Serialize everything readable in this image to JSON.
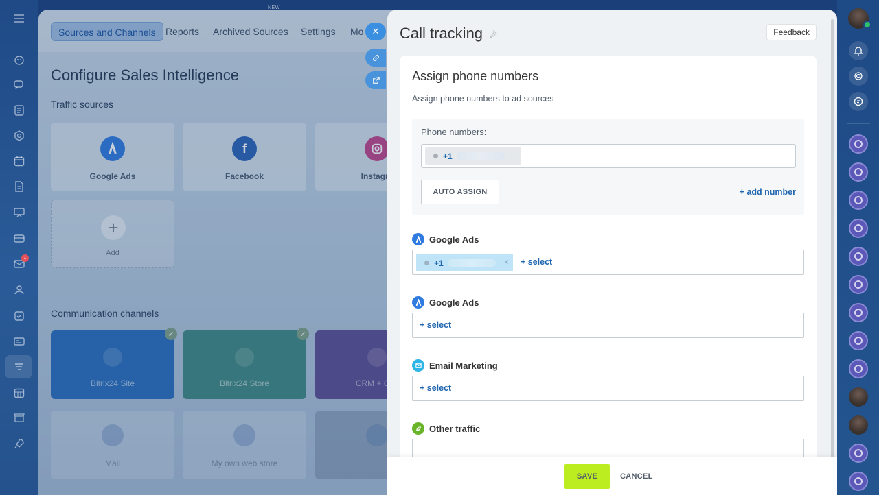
{
  "colors": {
    "accent_blue": "#2067b0",
    "save_green": "#bbed21",
    "frame_blue": "#1b3f78",
    "google_ads_icon": "#2f7be0",
    "email_icon": "#2fb4e8",
    "other_traffic_icon": "#6ab42a"
  },
  "icons": {
    "leftbar": [
      "menu-icon",
      "bot-icon",
      "chat-icon",
      "feed-icon",
      "hexagon-icon",
      "calendar-icon",
      "document-icon",
      "presentation-icon",
      "card-icon",
      "mail-icon",
      "users-icon",
      "checkbox-icon",
      "contact-card-icon",
      "filter-icon",
      "calendar-grid-icon",
      "store-icon",
      "rocket-icon"
    ],
    "rightbar": [
      "avatar",
      "bell-icon",
      "spiral-icon",
      "support-chat-icon"
    ]
  },
  "top_badge": "NEW",
  "background_app": {
    "tabs": [
      "Sources and Channels",
      "Reports",
      "Archived Sources",
      "Settings",
      "Mo"
    ],
    "title": "Configure Sales Intelligence",
    "traffic_title": "Traffic sources",
    "traffic_sources": [
      "Google Ads",
      "Facebook",
      "Instagra"
    ],
    "add_label": "Add",
    "channels_title": "Communication channels",
    "channels": [
      "Bitrix24 Site",
      "Bitrix24 Store",
      "CRM + Onli"
    ],
    "channels_row2": [
      "Mail",
      "My own web store"
    ],
    "mail_badge": "1"
  },
  "panel": {
    "title": "Call tracking",
    "feedback": "Feedback",
    "section_title": "Assign phone numbers",
    "section_subtitle": "Assign phone numbers to ad sources",
    "phone_label": "Phone numbers:",
    "phone_chip": "+1",
    "auto_assign": "AUTO ASSIGN",
    "add_number": "+ add number",
    "sources": [
      {
        "name": "Google Ads",
        "tag": "+1",
        "select": "+ select"
      },
      {
        "name": "Google Ads",
        "select": "+  select"
      },
      {
        "name": "Email Marketing",
        "select": "+  select"
      },
      {
        "name": "Other traffic"
      }
    ]
  },
  "footer": {
    "save": "SAVE",
    "cancel": "CANCEL"
  }
}
